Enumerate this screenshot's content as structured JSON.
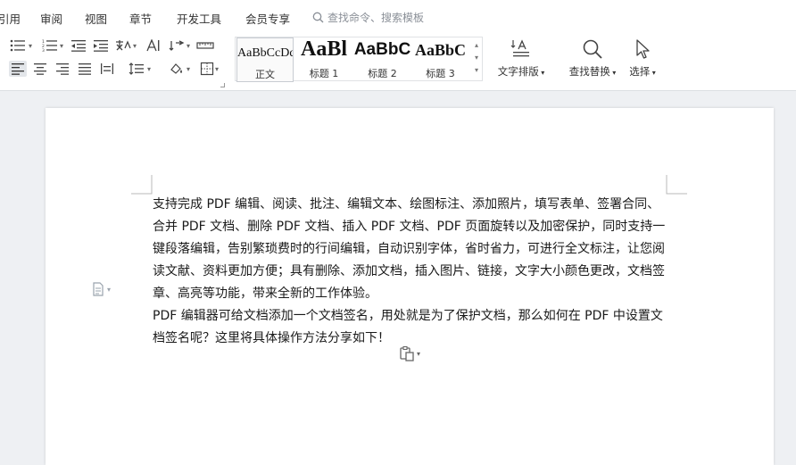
{
  "menu": {
    "items": [
      "引用",
      "审阅",
      "视图",
      "章节",
      "开发工具",
      "会员专享"
    ],
    "search_placeholder": "查找命令、搜索模板"
  },
  "styles": {
    "previews": [
      "AaBbCcDd",
      "AaBl",
      "AaBbC",
      "AaBbC"
    ],
    "names": [
      "正文",
      "标题 1",
      "标题 2",
      "标题 3"
    ]
  },
  "tools": {
    "text_layout": "文字排版",
    "find_replace": "查找替换",
    "select": "选择"
  },
  "document": {
    "paragraphs": [
      "支持完成 PDF 编辑、阅读、批注、编辑文本、绘图标注、添加照片，填写表单、签署合同、合并 PDF 文档、删除 PDF 文档、插入 PDF 文档、PDF 页面旋转以及加密保护，同时支持一键段落编辑，告别繁琐费时的行间编辑，自动识别字体，省时省力，可进行全文标注，让您阅读文献、资料更加方便；具有删除、添加文档，插入图片、链接，文字大小颜色更改，文档签章、高亮等功能，带来全新的工作体验。",
      "PDF 编辑器可给文档添加一个文档签名，用处就是为了保护文档，那么如何在 PDF 中设置文档签名呢？这里将具体操作方法分享如下！"
    ]
  },
  "colors": {
    "accent": "#2b579a",
    "ribbon_bg": "#ffffff",
    "workspace_bg": "#eef0f3"
  }
}
